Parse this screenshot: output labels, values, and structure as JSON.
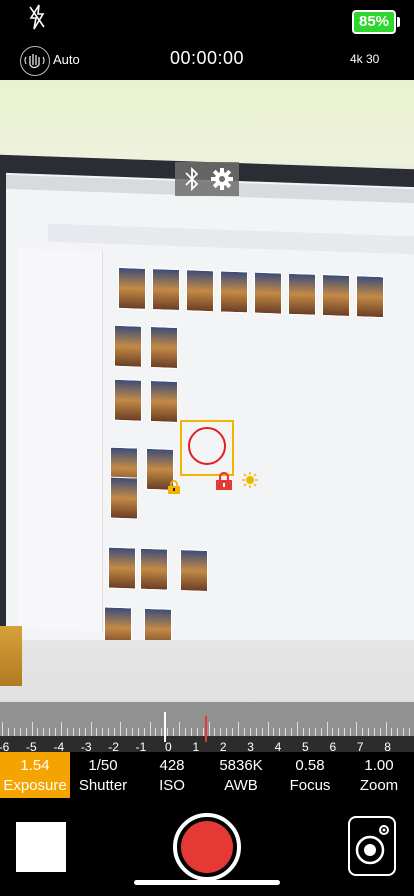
{
  "status": {
    "battery_text": "85%",
    "stabilization_label": "Auto",
    "timer": "00:00:00",
    "format": "4k 30"
  },
  "icons": {
    "flash": "flash-off-icon",
    "stabilization": "hand-stabilization-icon",
    "bluetooth": "bluetooth-icon",
    "settings": "gear-icon",
    "focus_lock": "lock-icon",
    "exposure_lock": "lock-icon",
    "exposure_sun": "sun-icon",
    "camera_switch": "camera-switch-icon"
  },
  "dial": {
    "numbers": [
      "-6",
      "-5",
      "-4",
      "-3",
      "-2",
      "-1",
      "0",
      "1",
      "2",
      "3",
      "4",
      "5",
      "6",
      "7",
      "8"
    ]
  },
  "controls": [
    {
      "value": "1.54",
      "name": "Exposure"
    },
    {
      "value": "1/50",
      "name": "Shutter"
    },
    {
      "value": "428",
      "name": "ISO"
    },
    {
      "value": "5836K",
      "name": "AWB"
    },
    {
      "value": "0.58",
      "name": "Focus"
    },
    {
      "value": "1.00",
      "name": "Zoom"
    }
  ],
  "colors": {
    "battery_green": "#2fd62f",
    "exposure_active": "#f5a300",
    "record_red": "#e53935",
    "focus_box": "#f2b400",
    "focus_circle": "#e02020"
  }
}
